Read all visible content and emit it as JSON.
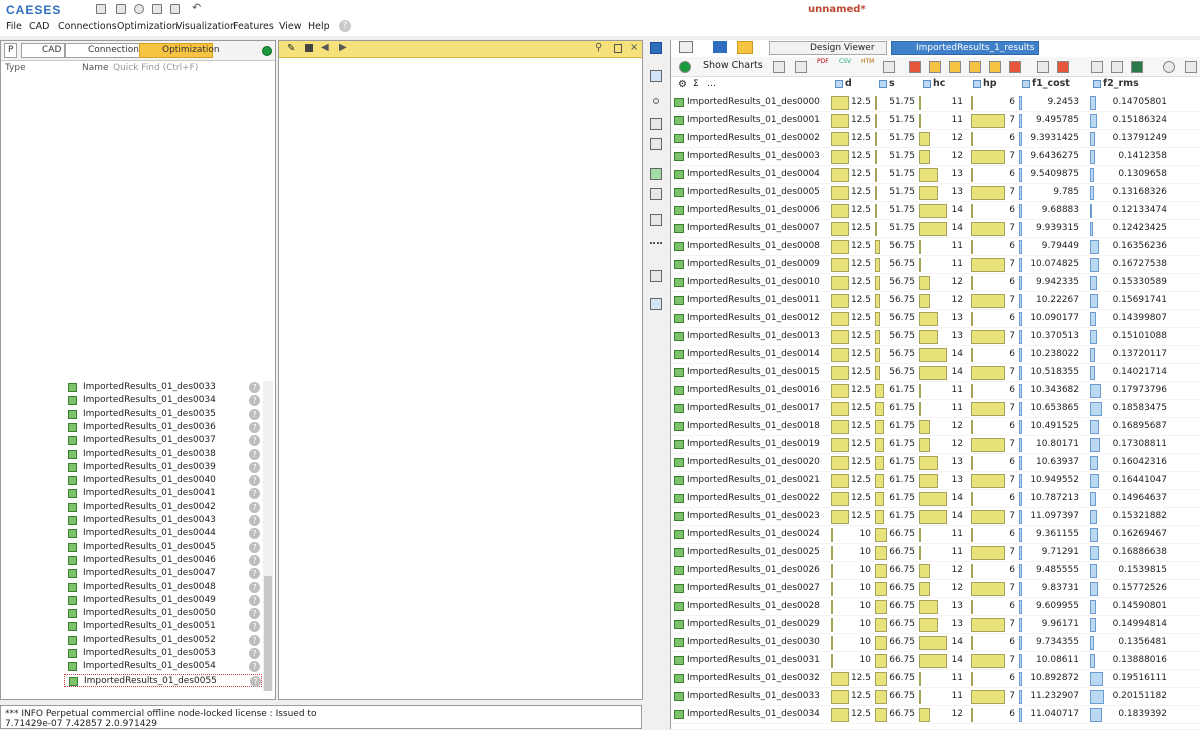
{
  "app": {
    "logo": "CAESES",
    "title": "unnamed*"
  },
  "menu": [
    "File",
    "CAD",
    "Connections",
    "Optimization",
    "Visualization",
    "Features",
    "View",
    "Help"
  ],
  "left_panel": {
    "tabs": {
      "p": "P",
      "cad": "CAD",
      "connections": "Connections",
      "optimization": "Optimization"
    },
    "col_type": "Type",
    "col_name": "Name",
    "quickfind": "Quick Find (Ctrl+F)",
    "items": [
      "ImportedResults_01_des0033",
      "ImportedResults_01_des0034",
      "ImportedResults_01_des0035",
      "ImportedResults_01_des0036",
      "ImportedResults_01_des0037",
      "ImportedResults_01_des0038",
      "ImportedResults_01_des0039",
      "ImportedResults_01_des0040",
      "ImportedResults_01_des0041",
      "ImportedResults_01_des0042",
      "ImportedResults_01_des0043",
      "ImportedResults_01_des0044",
      "ImportedResults_01_des0045",
      "ImportedResults_01_des0046",
      "ImportedResults_01_des0047",
      "ImportedResults_01_des0048",
      "ImportedResults_01_des0049",
      "ImportedResults_01_des0050",
      "ImportedResults_01_des0051",
      "ImportedResults_01_des0052",
      "ImportedResults_01_des0053",
      "ImportedResults_01_des0054",
      "ImportedResults_01_des0055"
    ]
  },
  "console": {
    "line1": "*** INFO Perpetual commercial offline node-locked license : Issued to",
    "line2": "7.71429e-07 7.42857 2.0.971429"
  },
  "right_panel": {
    "tabs": {
      "design_viewer": "Design Viewer",
      "results": "ImportedResults_1_results"
    },
    "show_charts": "Show Charts",
    "export": {
      "pdf": "PDF",
      "csv": "CSV",
      "htm": "HTM"
    },
    "columns": [
      "d",
      "s",
      "hc",
      "hp",
      "f1_cost",
      "f2_rms"
    ],
    "rows": [
      [
        "ImportedResults_01_des0000",
        "12.5",
        "51.75",
        "11",
        "6",
        "9.2453",
        "0.14705801"
      ],
      [
        "ImportedResults_01_des0001",
        "12.5",
        "51.75",
        "11",
        "7",
        "9.495785",
        "0.15186324"
      ],
      [
        "ImportedResults_01_des0002",
        "12.5",
        "51.75",
        "12",
        "6",
        "9.3931425",
        "0.13791249"
      ],
      [
        "ImportedResults_01_des0003",
        "12.5",
        "51.75",
        "12",
        "7",
        "9.6436275",
        "0.1412358"
      ],
      [
        "ImportedResults_01_des0004",
        "12.5",
        "51.75",
        "13",
        "6",
        "9.5409875",
        "0.1309658"
      ],
      [
        "ImportedResults_01_des0005",
        "12.5",
        "51.75",
        "13",
        "7",
        "9.785",
        "0.13168326"
      ],
      [
        "ImportedResults_01_des0006",
        "12.5",
        "51.75",
        "14",
        "6",
        "9.68883",
        "0.12133474"
      ],
      [
        "ImportedResults_01_des0007",
        "12.5",
        "51.75",
        "14",
        "7",
        "9.939315",
        "0.12423425"
      ],
      [
        "ImportedResults_01_des0008",
        "12.5",
        "56.75",
        "11",
        "6",
        "9.79449",
        "0.16356236"
      ],
      [
        "ImportedResults_01_des0009",
        "12.5",
        "56.75",
        "11",
        "7",
        "10.074825",
        "0.16727538"
      ],
      [
        "ImportedResults_01_des0010",
        "12.5",
        "56.75",
        "12",
        "6",
        "9.942335",
        "0.15330589"
      ],
      [
        "ImportedResults_01_des0011",
        "12.5",
        "56.75",
        "12",
        "7",
        "10.22267",
        "0.15691741"
      ],
      [
        "ImportedResults_01_des0012",
        "12.5",
        "56.75",
        "13",
        "6",
        "10.090177",
        "0.14399807"
      ],
      [
        "ImportedResults_01_des0013",
        "12.5",
        "56.75",
        "13",
        "7",
        "10.370513",
        "0.15101088"
      ],
      [
        "ImportedResults_01_des0014",
        "12.5",
        "56.75",
        "14",
        "6",
        "10.238022",
        "0.13720117"
      ],
      [
        "ImportedResults_01_des0015",
        "12.5",
        "56.75",
        "14",
        "7",
        "10.518355",
        "0.14021714"
      ],
      [
        "ImportedResults_01_des0016",
        "12.5",
        "61.75",
        "11",
        "6",
        "10.343682",
        "0.17973796"
      ],
      [
        "ImportedResults_01_des0017",
        "12.5",
        "61.75",
        "11",
        "7",
        "10.653865",
        "0.18583475"
      ],
      [
        "ImportedResults_01_des0018",
        "12.5",
        "61.75",
        "12",
        "6",
        "10.491525",
        "0.16895687"
      ],
      [
        "ImportedResults_01_des0019",
        "12.5",
        "61.75",
        "12",
        "7",
        "10.80171",
        "0.17308811"
      ],
      [
        "ImportedResults_01_des0020",
        "12.5",
        "61.75",
        "13",
        "6",
        "10.63937",
        "0.16042316"
      ],
      [
        "ImportedResults_01_des0021",
        "12.5",
        "61.75",
        "13",
        "7",
        "10.949552",
        "0.16441047"
      ],
      [
        "ImportedResults_01_des0022",
        "12.5",
        "61.75",
        "14",
        "6",
        "10.787213",
        "0.14964637"
      ],
      [
        "ImportedResults_01_des0023",
        "12.5",
        "61.75",
        "14",
        "7",
        "11.097397",
        "0.15321882"
      ],
      [
        "ImportedResults_01_des0024",
        "10",
        "66.75",
        "11",
        "6",
        "9.361155",
        "0.16269467"
      ],
      [
        "ImportedResults_01_des0025",
        "10",
        "66.75",
        "11",
        "7",
        "9.71291",
        "0.16886638"
      ],
      [
        "ImportedResults_01_des0026",
        "10",
        "66.75",
        "12",
        "6",
        "9.485555",
        "0.1539815"
      ],
      [
        "ImportedResults_01_des0027",
        "10",
        "66.75",
        "12",
        "7",
        "9.83731",
        "0.15772526"
      ],
      [
        "ImportedResults_01_des0028",
        "10",
        "66.75",
        "13",
        "6",
        "9.609955",
        "0.14590801"
      ],
      [
        "ImportedResults_01_des0029",
        "10",
        "66.75",
        "13",
        "7",
        "9.96171",
        "0.14994814"
      ],
      [
        "ImportedResults_01_des0030",
        "10",
        "66.75",
        "14",
        "6",
        "9.734355",
        "0.1356481"
      ],
      [
        "ImportedResults_01_des0031",
        "10",
        "66.75",
        "14",
        "7",
        "10.08611",
        "0.13888016"
      ],
      [
        "ImportedResults_01_des0032",
        "12.5",
        "66.75",
        "11",
        "6",
        "10.892872",
        "0.19516111"
      ],
      [
        "ImportedResults_01_des0033",
        "12.5",
        "66.75",
        "11",
        "7",
        "11.232907",
        "0.20151182"
      ],
      [
        "ImportedResults_01_des0034",
        "12.5",
        "66.75",
        "12",
        "6",
        "11.040717",
        "0.1839392"
      ]
    ]
  }
}
